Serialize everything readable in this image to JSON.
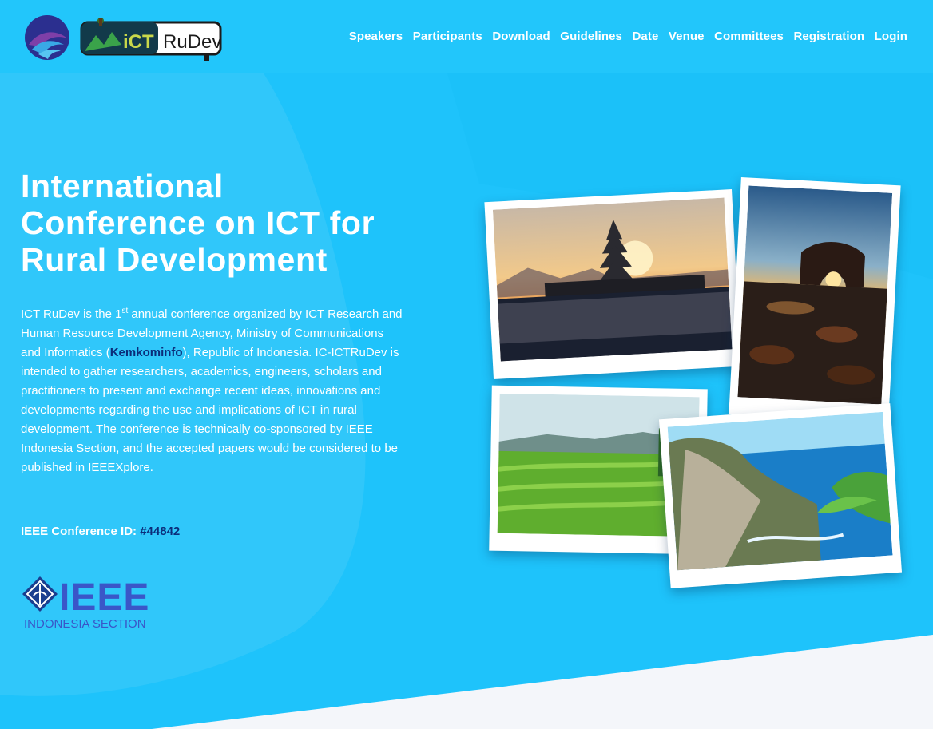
{
  "header": {
    "kominfo_logo": "kominfo-logo",
    "brand_prefix": "iCT",
    "brand_suffix": "RuDev",
    "nav": [
      {
        "label": "Speakers"
      },
      {
        "label": "Participants"
      },
      {
        "label": "Download"
      },
      {
        "label": "Guidelines"
      },
      {
        "label": "Date"
      },
      {
        "label": "Venue"
      },
      {
        "label": "Committees"
      },
      {
        "label": "Registration"
      },
      {
        "label": "Login"
      }
    ]
  },
  "hero": {
    "title_line1": "International",
    "title_line2": "Conference on ICT for",
    "title_line3": "Rural Development",
    "desc_part1": "ICT RuDev is the 1",
    "desc_sup": "st",
    "desc_part2": " annual conference organized by ICT Research and Human Resource Development Agency, Ministry of Communications and Informatics (",
    "desc_link": "Kemkominfo",
    "desc_part3": "), Republic of Indonesia. IC-ICTRuDev is intended to gather researchers, academics, engineers, scholars and practitioners to present and exchange recent ideas, innovations and developments regarding the use and implications of ICT in rural development. The conference is technically co-sponsored by IEEE Indonesia Section, and the accepted papers would be considered to be published in IEEEXplore.",
    "conference_id_label": "IEEE Conference ID: ",
    "conference_id_value": "#44842"
  },
  "ieee_logo": {
    "wordmark": "IEEE",
    "section": "INDONESIA SECTION"
  },
  "colors": {
    "background": "#1ec3fb",
    "link": "#0b2d7a",
    "bottom_band": "#f4f6fa"
  }
}
